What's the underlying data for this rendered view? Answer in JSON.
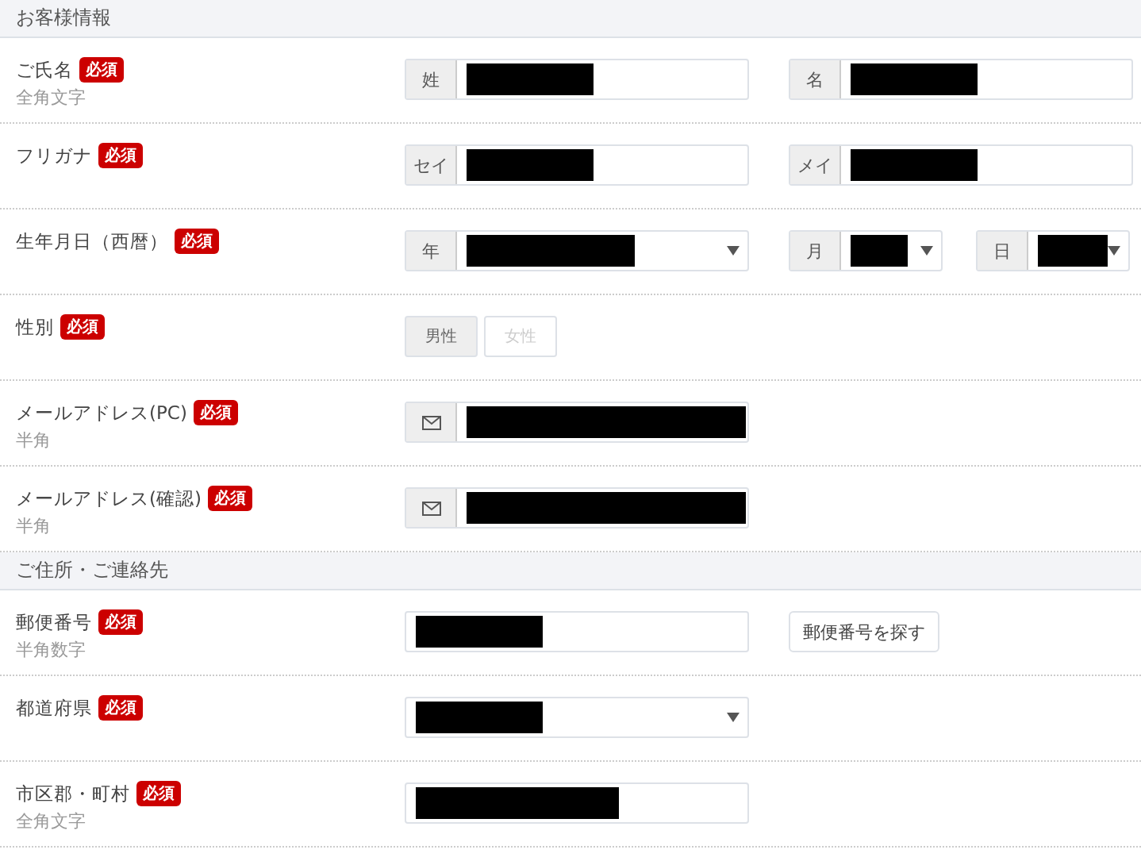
{
  "sections": [
    {
      "title": "お客様情報",
      "rows": [
        {
          "kind": "pair",
          "label": "ご氏名",
          "badge": "必須",
          "note": "全角文字",
          "fields": [
            {
              "prefix": "姓"
            },
            {
              "prefix": "名"
            }
          ]
        },
        {
          "kind": "pair",
          "label": "フリガナ",
          "badge": "必須",
          "fields": [
            {
              "prefix": "セイ"
            },
            {
              "prefix": "メイ"
            }
          ]
        },
        {
          "kind": "date",
          "label": "生年月日（西暦）",
          "badge": "必須",
          "fields": [
            {
              "prefix": "年"
            },
            {
              "prefix": "月"
            },
            {
              "prefix": "日"
            }
          ]
        },
        {
          "kind": "toggle",
          "label": "性別",
          "badge": "必須",
          "options": [
            {
              "label": "男性",
              "selected": true
            },
            {
              "label": "女性",
              "selected": false
            }
          ]
        },
        {
          "kind": "email",
          "label": "メールアドレス(PC)",
          "badge": "必須",
          "note": "半角"
        },
        {
          "kind": "email",
          "label": "メールアドレス(確認)",
          "badge": "必須",
          "note": "半角"
        }
      ]
    },
    {
      "title": "ご住所・ご連絡先",
      "rows": [
        {
          "kind": "text",
          "label": "郵便番号",
          "badge": "必須",
          "note": "半角数字",
          "button": "郵便番号を探す"
        },
        {
          "kind": "select",
          "label": "都道府県",
          "badge": "必須"
        },
        {
          "kind": "text",
          "label": "市区郡・町村",
          "badge": "必須",
          "note": "全角文字"
        }
      ]
    }
  ]
}
